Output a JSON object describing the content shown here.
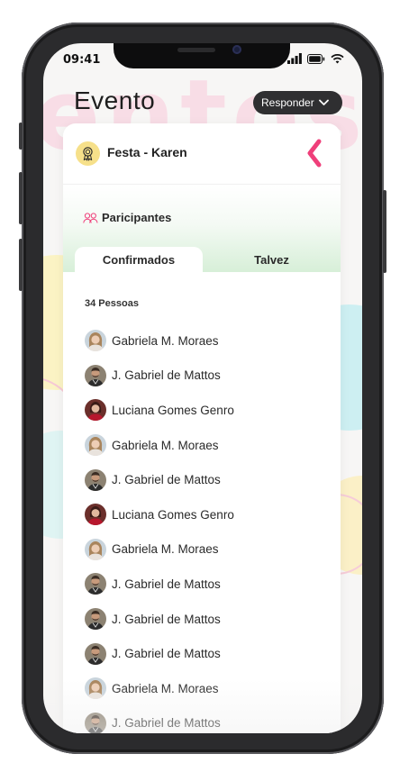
{
  "status_bar": {
    "time": "09:41"
  },
  "header": {
    "title": "Evento",
    "respond_label": "Responder"
  },
  "background_text": "entos",
  "event": {
    "name": "Festa - Karen"
  },
  "participants": {
    "label": "Paricipantes",
    "tabs": [
      {
        "label": "Confirmados",
        "active": true
      },
      {
        "label": "Talvez",
        "active": false
      }
    ],
    "count_label": "34 Pessoas",
    "people": [
      {
        "name": "Gabriela M. Moraes",
        "avatar": "female-blonde"
      },
      {
        "name": "J. Gabriel de Mattos",
        "avatar": "male-bearded"
      },
      {
        "name": "Luciana Gomes Genro",
        "avatar": "female-red"
      },
      {
        "name": "Gabriela M. Moraes",
        "avatar": "female-blonde"
      },
      {
        "name": "J. Gabriel de Mattos",
        "avatar": "male-bearded"
      },
      {
        "name": "Luciana Gomes Genro",
        "avatar": "female-red"
      },
      {
        "name": "Gabriela M. Moraes",
        "avatar": "female-blonde"
      },
      {
        "name": "J. Gabriel de Mattos",
        "avatar": "male-bearded"
      },
      {
        "name": "J. Gabriel de Mattos",
        "avatar": "male-bearded"
      },
      {
        "name": "J. Gabriel de Mattos",
        "avatar": "male-bearded"
      },
      {
        "name": "Gabriela M. Moraes",
        "avatar": "female-blonde"
      },
      {
        "name": "J. Gabriel de Mattos",
        "avatar": "male-bearded"
      }
    ]
  },
  "colors": {
    "accent_pink": "#ef3f7a",
    "respond_bg": "#2f2f31",
    "event_icon_bg": "#f6e08a",
    "tab_band_green": "#d7efd8"
  },
  "icons": {
    "event": "award-badge-icon",
    "back": "chevron-left-icon",
    "participants": "users-icon",
    "respond_chevron": "chevron-down-icon",
    "signal": "signal-icon",
    "battery": "battery-icon",
    "wifi": "wifi-icon"
  }
}
